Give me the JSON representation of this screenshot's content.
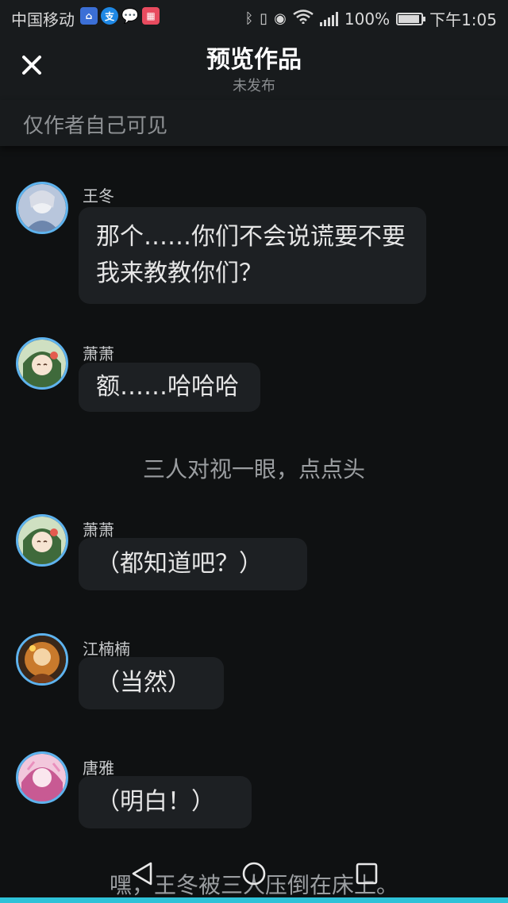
{
  "status_bar": {
    "carrier": "中国移动",
    "battery": "100%",
    "battery_level": 1.0,
    "time": "下午1:05",
    "icons": [
      "baidu-icon",
      "alipay-icon",
      "message-icon",
      "app-icon",
      "bluetooth-icon",
      "vibrate-icon",
      "eye-icon",
      "wifi-icon",
      "signal-icon",
      "battery-icon"
    ]
  },
  "header": {
    "title": "预览作品",
    "subtitle": "未发布",
    "close_icon": "close-icon"
  },
  "visibility": {
    "text": "仅作者自己可见"
  },
  "messages": [
    {
      "type": "bubble",
      "sender": "王冬",
      "text": "那个……你们不会说谎要不要我来教教你们？",
      "avatar_color": "#8fa7c8"
    },
    {
      "type": "bubble",
      "sender": "萧萧",
      "text": "额……哈哈哈",
      "avatar_color": "#6fa36a"
    },
    {
      "type": "narration",
      "text": "三人对视一眼，点点头"
    },
    {
      "type": "bubble",
      "sender": "萧萧",
      "text": "（都知道吧？）",
      "avatar_color": "#6fa36a"
    },
    {
      "type": "bubble",
      "sender": "江楠楠",
      "text": "（当然）",
      "avatar_color": "#d99a3a"
    },
    {
      "type": "bubble",
      "sender": "唐雅",
      "text": "（明白！）",
      "avatar_color": "#d07aa8"
    },
    {
      "type": "narration",
      "text": "嘿，王冬被三人压倒在床上。"
    }
  ],
  "nav": {
    "back_icon": "back-triangle-icon",
    "home_icon": "home-circle-icon",
    "recent_icon": "recent-square-icon"
  },
  "colors": {
    "background": "#0f1112",
    "header": "#181b1d",
    "bubble": "#1d2023",
    "avatar_ring": "#5eb3ee",
    "accent": "#2ec2d8"
  }
}
